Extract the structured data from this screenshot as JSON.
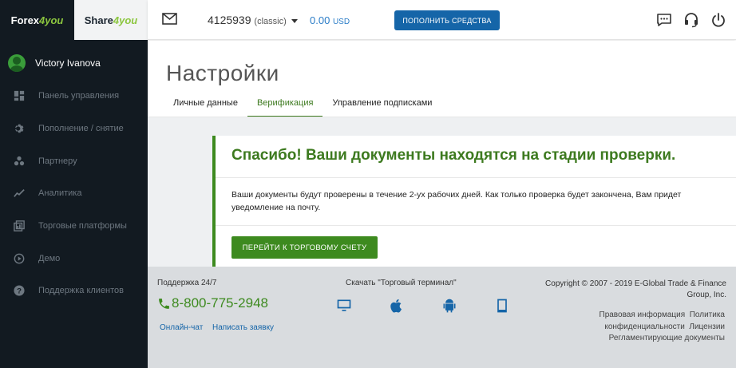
{
  "brands": {
    "forex_left": "Forex",
    "forex_four": "4you",
    "share_left": "Share",
    "share_four": "4you"
  },
  "user": {
    "name": "Victory Ivanova"
  },
  "nav": {
    "items": [
      {
        "label": "Панель управления",
        "icon": "dashboard-icon"
      },
      {
        "label": "Пополнение / снятие",
        "icon": "gear-icon"
      },
      {
        "label": "Партнеру",
        "icon": "partner-icon"
      },
      {
        "label": "Аналитика",
        "icon": "chart-line-icon"
      },
      {
        "label": "Торговые платформы",
        "icon": "platforms-icon"
      },
      {
        "label": "Демо",
        "icon": "play-icon"
      },
      {
        "label": "Поддержка клиентов",
        "icon": "help-icon"
      }
    ]
  },
  "topbar": {
    "account_number": "4125939",
    "account_type": "(classic)",
    "balance_value": "0.00",
    "balance_currency": "USD",
    "deposit_label": "ПОПОЛНИТЬ СРЕДСТВА"
  },
  "page": {
    "title": "Настройки",
    "tabs": [
      {
        "label": "Личные данные",
        "active": false
      },
      {
        "label": "Верификация",
        "active": true
      },
      {
        "label": "Управление подписками",
        "active": false
      }
    ]
  },
  "card": {
    "title": "Спасибо! Ваши документы находятся на стадии проверки.",
    "text": "Ваши документы будут проверены в течение 2-ух рабочих дней. Как только проверка будет закончена, Вам придет уведомление на почту.",
    "button_label": "ПЕРЕЙТИ К ТОРГОВОМУ СЧЕТУ"
  },
  "footer": {
    "support_label": "Поддержка 24/7",
    "phone": "8-800-775-2948",
    "chat_link": "Онлайн-чат",
    "request_link": "Написать заявку",
    "download_label": "Скачать \"Торговый терминал\"",
    "copyright": "Copyright © 2007 - 2019 E-Global Trade & Finance Group, Inc.",
    "legal_info": "Правовая информация",
    "policy": "Политика",
    "privacy": "конфиденциальности",
    "licenses": "Лицензии",
    "regulatory_docs": "Регламентирующие документы"
  },
  "colors": {
    "sidebar_bg": "#121a21",
    "accent_green": "#3d8a1f",
    "accent_blue": "#1565a8",
    "footer_bg": "#d9dcdf"
  }
}
